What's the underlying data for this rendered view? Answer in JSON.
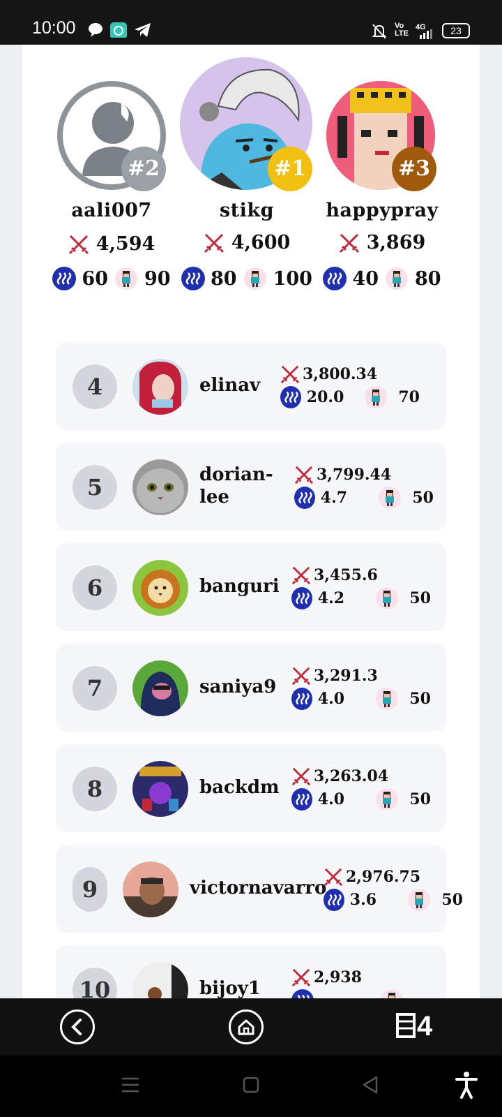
{
  "status_bar": {
    "time": "10:00",
    "battery": "23",
    "network": "4G",
    "volte_top": "Vo",
    "volte_bottom": "LTE",
    "icons": [
      "chat-icon",
      "app-icon",
      "telegram-icon",
      "mute-icon",
      "signal-icon"
    ]
  },
  "podium": [
    {
      "rank_label": "#2",
      "name": "aali007",
      "score": "4,594",
      "steem": "60",
      "char": "90",
      "badge_color": "#9aa0a6"
    },
    {
      "rank_label": "#1",
      "name": "stikg",
      "score": "4,600",
      "steem": "80",
      "char": "100",
      "badge_color": "#f2c010"
    },
    {
      "rank_label": "#3",
      "name": "happypray",
      "score": "3,869",
      "steem": "40",
      "char": "80",
      "badge_color": "#a05a0c"
    }
  ],
  "leaderboard": [
    {
      "rank": "4",
      "name_line1": "elinav",
      "name_line2": "",
      "score": "3,800.34",
      "steem": "20.0",
      "char": "70"
    },
    {
      "rank": "5",
      "name_line1": "dorian-",
      "name_line2": "lee",
      "score": "3,799.44",
      "steem": "4.7",
      "char": "50"
    },
    {
      "rank": "6",
      "name_line1": "banguri",
      "name_line2": "",
      "score": "3,455.6",
      "steem": "4.2",
      "char": "50"
    },
    {
      "rank": "7",
      "name_line1": "saniya9",
      "name_line2": "",
      "score": "3,291.3",
      "steem": "4.0",
      "char": "50"
    },
    {
      "rank": "8",
      "name_line1": "backdm",
      "name_line2": "",
      "score": "3,263.04",
      "steem": "4.0",
      "char": "50"
    },
    {
      "rank": "9",
      "name_line1": "victornavarro",
      "name_line2": "",
      "score": "2,976.75",
      "steem": "3.6",
      "char": "50"
    },
    {
      "rank": "10",
      "name_line1": "bijoy1",
      "name_line2": "",
      "score": "2,938",
      "steem": "",
      "char": ""
    }
  ],
  "app_nav": {
    "logo": "4",
    "buttons": [
      "back-button",
      "home-button"
    ]
  },
  "colors": {
    "steem_blue": "#1f2fb0",
    "sword_red": "#c0283a",
    "row_bg": "#f6f7f9",
    "rank_circle": "#d3d6dc"
  }
}
